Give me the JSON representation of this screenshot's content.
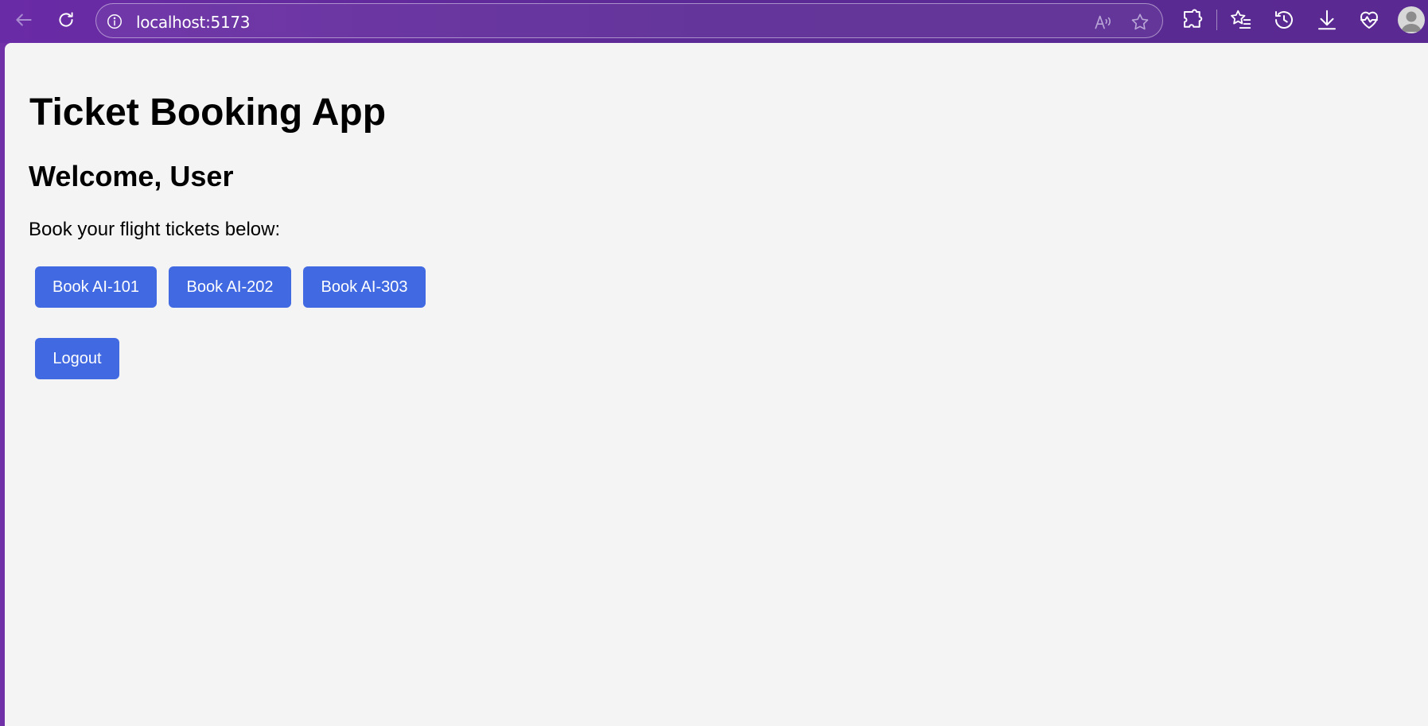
{
  "browser": {
    "url": "localhost:5173",
    "icons": [
      "back-icon",
      "refresh-icon",
      "site-info-icon",
      "read-aloud-icon",
      "favorite-star-icon",
      "extensions-icon",
      "favorites-icon",
      "history-icon",
      "downloads-icon",
      "browser-essentials-icon",
      "profile-avatar"
    ],
    "colors": {
      "frame": "#5b2a95",
      "page_bg": "#f4f4f4",
      "button": "#4169e1"
    }
  },
  "app": {
    "title": "Ticket Booking App",
    "welcome": "Welcome, User",
    "prompt": "Book your flight tickets below:",
    "flights": [
      {
        "label": "Book AI-101"
      },
      {
        "label": "Book AI-202"
      },
      {
        "label": "Book AI-303"
      }
    ],
    "logout_label": "Logout"
  }
}
